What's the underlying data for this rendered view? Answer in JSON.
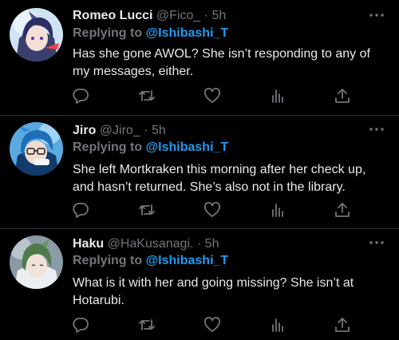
{
  "tweets": [
    {
      "name": "Romeo Lucci",
      "handle": "@Fico_",
      "separator": "·",
      "time": "5h",
      "replying_prefix": "Replying to",
      "replying_to": "@Ishibashi_T",
      "text": "Has she gone AWOL? She isn’t responding to any of my messages, either."
    },
    {
      "name": "Jiro",
      "handle": "@Jiro_",
      "separator": "·",
      "time": "5h",
      "replying_prefix": "Replying to",
      "replying_to": "@Ishibashi_T",
      "text": "She left Mortkraken this morning after her check up, and hasn’t returned. She’s also not in the library."
    },
    {
      "name": "Haku",
      "handle": "@HaKusanagi.",
      "separator": "·",
      "time": "5h",
      "replying_prefix": "Replying to",
      "replying_to": "@Ishibashi_T",
      "text": "What is it with her and going missing? She isn’t at Hotarubi."
    }
  ],
  "colors": {
    "background": "#000000",
    "text": "#e7e9ea",
    "secondary": "#71767b",
    "mention": "#1d9bf0",
    "divider": "#2f3336"
  },
  "icons": [
    "reply-icon",
    "retweet-icon",
    "like-icon",
    "analytics-icon",
    "share-icon",
    "more-icon"
  ]
}
